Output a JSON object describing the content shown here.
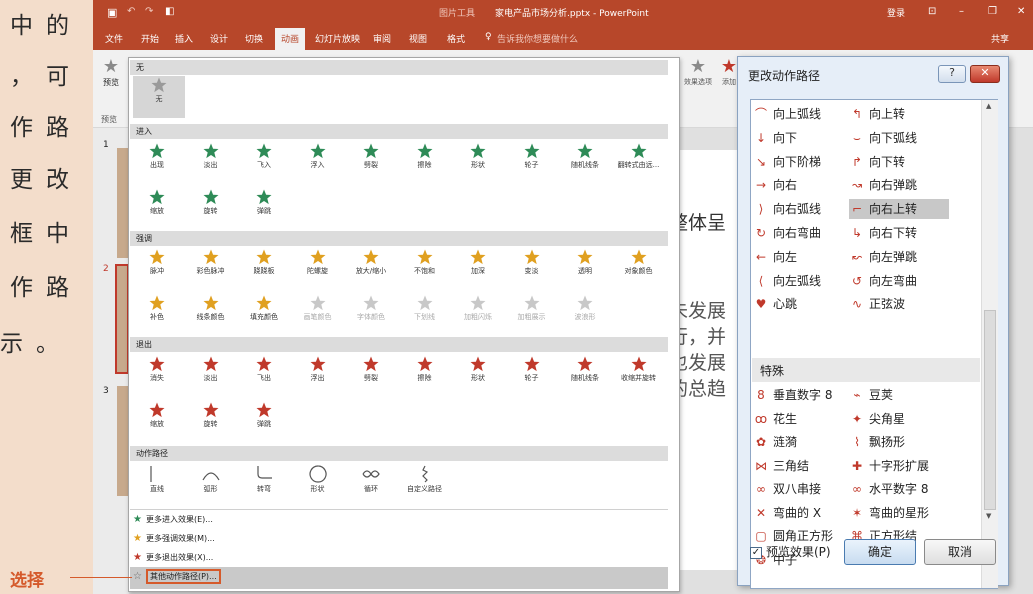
{
  "book": {
    "lines": [
      "中的",
      "，可",
      "作路",
      "更改",
      "框中",
      "作路",
      "示。"
    ],
    "callout_label": "选择"
  },
  "titlebar": {
    "save_icon": "save-icon",
    "undo_icon": "undo-icon",
    "redo_icon": "redo-icon",
    "start_icon": "start-icon",
    "contextual_tab": "图片工具",
    "document_title": "家电产品市场分析.pptx - PowerPoint",
    "login": "登录"
  },
  "tabs": [
    "文件",
    "开始",
    "插入",
    "设计",
    "切换",
    "动画",
    "幻灯片放映",
    "审阅",
    "视图",
    "格式"
  ],
  "active_tab": "动画",
  "tell_me": "告诉我你想要做什么",
  "share": "共享",
  "ribbon": {
    "preview": "预览",
    "preview_group": "预览",
    "effect_options": "效果选项",
    "add_animation": "添加"
  },
  "slide_numbers": [
    "1",
    "2",
    "3"
  ],
  "slide_text": [
    "整体呈",
    "未发展",
    "行，并",
    "也发展",
    "的总趋"
  ],
  "gallery": {
    "sections": {
      "none": "无",
      "entrance": "进入",
      "emphasis": "强调",
      "exit": "退出",
      "motion": "动作路径"
    },
    "none_items": [
      "无"
    ],
    "entrance_items": [
      "出现",
      "淡出",
      "飞入",
      "浮入",
      "劈裂",
      "擦除",
      "形状",
      "轮子",
      "随机线条",
      "翻转式由远...",
      "缩放",
      "旋转",
      "弹跳"
    ],
    "emphasis_items": [
      "脉冲",
      "彩色脉冲",
      "跷跷板",
      "陀螺旋",
      "放大/缩小",
      "不饱和",
      "加深",
      "变淡",
      "透明",
      "对象颜色",
      "补色",
      "线条颜色",
      "填充颜色",
      "画笔颜色",
      "字体颜色",
      "下划线",
      "加粗闪烁",
      "加粗展示",
      "波浪形"
    ],
    "exit_items": [
      "消失",
      "淡出",
      "飞出",
      "浮出",
      "劈裂",
      "擦除",
      "形状",
      "轮子",
      "随机线条",
      "收缩并旋转",
      "缩放",
      "旋转",
      "弹跳"
    ],
    "motion_items": [
      "直线",
      "弧形",
      "转弯",
      "形状",
      "循环",
      "自定义路径"
    ],
    "footer": [
      "更多进入效果(E)...",
      "更多强调效果(M)...",
      "更多退出效果(X)...",
      "其他动作路径(P)..."
    ]
  },
  "colors": {
    "accent": "#b7472a",
    "entrance_star": "#2e8b57",
    "emphasis_star": "#e0a020",
    "exit_star": "#c0392b",
    "callout": "#d55a2b"
  },
  "dialog": {
    "title": "更改动作路径",
    "help": "?",
    "close": "✕",
    "basic_left": [
      "向上弧线",
      "向下",
      "向下阶梯",
      "向右",
      "向右弧线",
      "向右弯曲",
      "向左",
      "向左弧线",
      "心跳"
    ],
    "basic_right": [
      "向上转",
      "向下弧线",
      "向下转",
      "向右弹跳",
      "向右上转",
      "向右下转",
      "向左弹跳",
      "向左弯曲",
      "正弦波"
    ],
    "selected": "向右上转",
    "special_header": "特殊",
    "special_left": [
      "垂直数字 8",
      "花生",
      "涟漪",
      "三角结",
      "双八串接",
      "弯曲的 X",
      "圆角正方形",
      "中子"
    ],
    "special_right": [
      "豆荚",
      "尖角星",
      "飘扬形",
      "十字形扩展",
      "水平数字 8",
      "弯曲的星形",
      "正方形结"
    ],
    "preview_checkbox": "预览效果(P)",
    "ok": "确定",
    "cancel": "取消"
  }
}
